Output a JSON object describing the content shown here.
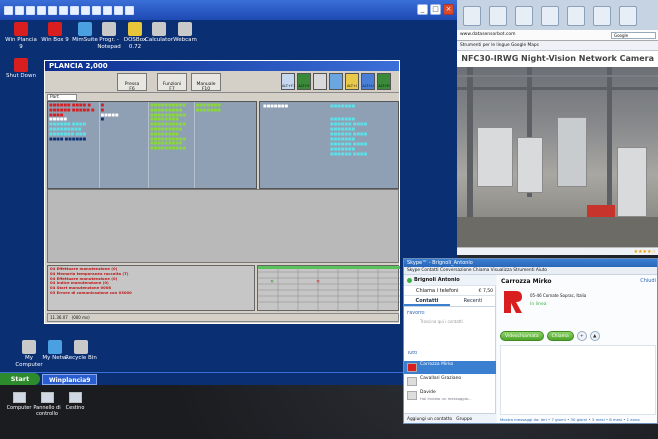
{
  "legacy": {
    "desktop_icons": [
      {
        "label": "Win Plancia 9",
        "icon": "winplancia-icon"
      },
      {
        "label": "Win Box 9",
        "icon": "winbox-icon"
      },
      {
        "label": "MimSuite",
        "icon": "mimsuite-icon"
      },
      {
        "label": "Progr. - Notepad",
        "icon": "notepad-icon"
      },
      {
        "label": "DOSBox 0.72",
        "icon": "dosbox-icon"
      },
      {
        "label": "Calculator",
        "icon": "calculator-icon"
      },
      {
        "label": "Webcam",
        "icon": "webcam-icon"
      },
      {
        "label": "Shut Down",
        "icon": "shutdown-icon"
      },
      {
        "label": "My Computer",
        "icon": "my-computer-icon"
      },
      {
        "label": "My Netw.",
        "icon": "network-icon"
      },
      {
        "label": "Recycle Bin",
        "icon": "recycle-bin-icon"
      }
    ],
    "taskbar": {
      "start": "Start",
      "task": "Winplancia9"
    }
  },
  "plancia": {
    "title": "PLANCIA 2,000",
    "buttons": [
      {
        "label": "Pressa",
        "key": "F6"
      },
      {
        "label": "Funzioni",
        "key": "F7"
      },
      {
        "label": "Manuale",
        "key": "F10"
      }
    ],
    "tool_labels": [
      "ALT+F1",
      "ALT+E",
      "",
      "",
      "ALT+I",
      "ALT+U",
      "ALT+R"
    ],
    "tab": "Part",
    "status": "11.36.07",
    "status_extra": "(000 ms)",
    "messages": [
      "04 Effettuare manutenzione (0)",
      "04 Memoria temporanea raccolta (T)",
      "04 Effettuare manutenzione (0)",
      "04 Indice manutenzione (0)",
      "04 Start manutenzione 0008",
      "03 Errore di comunicazione con 03000"
    ],
    "colors": {
      "alarm": "#c01818",
      "ok": "#8ad83a"
    }
  },
  "browser": {
    "address": "www.datasensorbot.com",
    "bookmarks": "Strumenti per le lingue  Google Maps",
    "search_placeholder": "Google",
    "heading": "NFC30-IRWG Night-Vision Network Camera",
    "rating": "★★★★☆"
  },
  "skype": {
    "title": "Skype™ - Brignoli_Antonio",
    "menu": "Skype  Contatti  Conversazione  Chiama  Visualizza  Strumenti  Aiuto",
    "user": "Brignoli Antonio",
    "calls": "Chiama i telefoni",
    "credit": "€ 7,50",
    "tabs": [
      "Contatti",
      "Recenti"
    ],
    "favorites_label": "Favoriti",
    "favorites_hint": "Trascina qui i contatti",
    "all_label": "Tutti",
    "contacts": [
      {
        "name": "Carrozza Mirko",
        "sub": ""
      },
      {
        "name": "Cavallari Graziano",
        "sub": ""
      },
      {
        "name": "Davide",
        "sub": "Hai inviato un messaggio..."
      }
    ],
    "bottom": "Aggiungi un contatto",
    "bottom_group": "Gruppo",
    "conversation": {
      "name": "Carrozza Mirko",
      "close": "Chiudi",
      "address": "05-46 Cornate Soprac, Italia",
      "presence": "In linea",
      "video_call": "Videochiamata",
      "call": "Chiama",
      "footer": "Mostra messaggi da: Ieri • 7 giorni • 30 giorni • 3 mesi • 6 mesi • 1 anno"
    }
  },
  "host_icons": [
    {
      "label": "Computer",
      "icon": "computer-icon"
    },
    {
      "label": "Pannello di controllo",
      "icon": "control-panel-icon"
    },
    {
      "label": "Cestino",
      "icon": "trash-icon"
    }
  ]
}
